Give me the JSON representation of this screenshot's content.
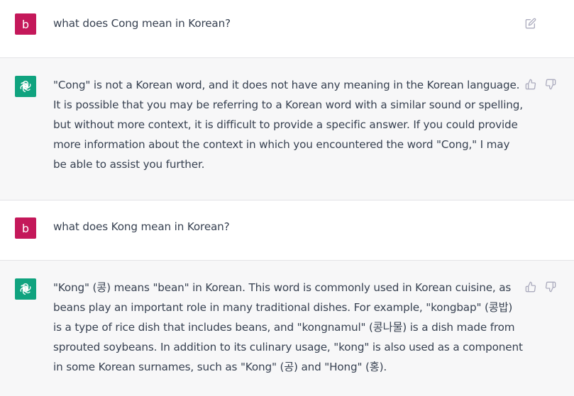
{
  "conversation": {
    "turns": [
      {
        "role": "user",
        "avatar_letter": "b",
        "text": "what does Cong mean in Korean?",
        "icon": "edit-icon"
      },
      {
        "role": "assistant",
        "icon_left": "openai-logo-icon",
        "text": "\"Cong\" is not a Korean word, and it does not have any meaning in the Korean language. It is possible that you may be referring to a Korean word with a similar sound or spelling, but without more context, it is difficult to provide a specific answer. If you could provide more information about the context in which you encountered the word \"Cong,\" I may be able to assist you further.",
        "actions": [
          "thumbs-up-icon",
          "thumbs-down-icon"
        ]
      },
      {
        "role": "user",
        "avatar_letter": "b",
        "text": "what does Kong mean in Korean?"
      },
      {
        "role": "assistant",
        "icon_left": "openai-logo-icon",
        "text": "\"Kong\" (콩) means \"bean\" in Korean. This word is commonly used in Korean cuisine, as beans play an important role in many traditional dishes. For example, \"kongbap\" (콩밥) is a type of rice dish that includes beans, and \"kongnamul\" (콩나물) is a dish made from sprouted soybeans. In addition to its culinary usage, \"kong\" is also used as a component in some Korean surnames, such as \"Kong\" (공) and \"Hong\" (홍).",
        "actions": [
          "thumbs-up-icon",
          "thumbs-down-icon"
        ]
      }
    ]
  },
  "colors": {
    "user_avatar": "#c4185a",
    "assistant_avatar": "#10a37f",
    "user_bg": "#ffffff",
    "assistant_bg": "#f7f7f8",
    "text": "#374151",
    "icon": "#acacbe"
  }
}
